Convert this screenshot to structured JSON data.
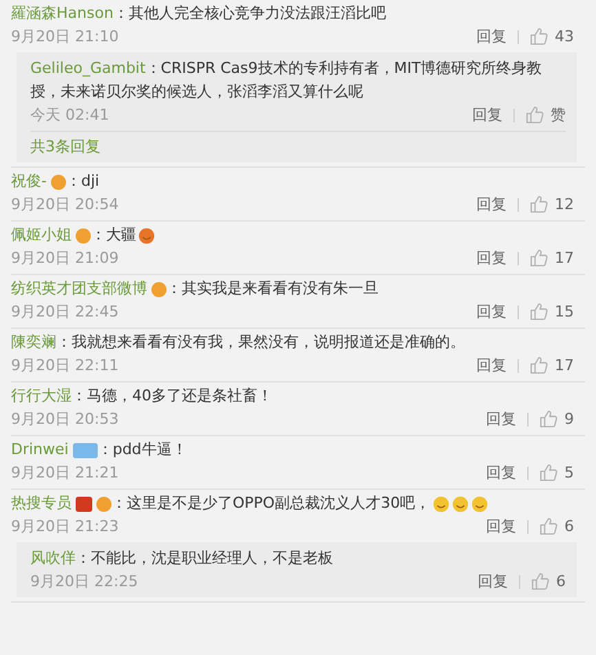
{
  "comments": [
    {
      "user": "羅涵森Hanson",
      "text": "：其他人完全核心竞争力没法跟汪滔比吧",
      "time": "9月20日 21:10",
      "reply": "回复",
      "likes": "43",
      "replies": [
        {
          "user": "Gelileo_Gambit",
          "text": "：CRISPR Cas9技术的专利持有者，MIT博德研究所终身教授，未来诺贝尔奖的候选人，张滔李滔又算什么呢",
          "time": "今天 02:41",
          "reply": "回复",
          "likes": "赞"
        }
      ],
      "more": "共3条回复"
    },
    {
      "user": "祝俊-",
      "badges": [
        {
          "kind": "fan"
        }
      ],
      "text": "：dji",
      "time": "9月20日 20:54",
      "reply": "回复",
      "likes": "12"
    },
    {
      "user": "佩姬小姐",
      "badges": [
        {
          "kind": "fan"
        }
      ],
      "text": "：大疆",
      "emojis": [
        {
          "kind": "fire"
        }
      ],
      "time": "9月20日 21:09",
      "reply": "回复",
      "likes": "17"
    },
    {
      "user": "纺织英才团支部微博",
      "badges": [
        {
          "kind": "fan"
        }
      ],
      "text": "：其实我是来看看有没有朱一旦",
      "time": "9月20日 22:45",
      "reply": "回复",
      "likes": "15"
    },
    {
      "user": "陳奕斓",
      "text": "：我就想来看看有没有我，果然没有，说明报道还是准确的。",
      "time": "9月20日 22:11",
      "reply": "回复",
      "likes": "17"
    },
    {
      "user": "行行大湿",
      "text": "：马德，40多了还是条社畜！",
      "time": "9月20日 20:53",
      "reply": "回复",
      "likes": "9"
    },
    {
      "user": "Drinwei",
      "badges": [
        {
          "kind": "member"
        }
      ],
      "text": "：pdd牛逼！",
      "time": "9月20日 21:21",
      "reply": "回复",
      "likes": "5"
    },
    {
      "user": "热搜专员",
      "badges": [
        {
          "kind": "verified"
        },
        {
          "kind": "fan"
        }
      ],
      "text": "：这里是不是少了OPPO副总裁沈义人才30吧，",
      "emojis": [
        {
          "kind": "laugh"
        },
        {
          "kind": "laugh"
        },
        {
          "kind": "laugh"
        }
      ],
      "time": "9月20日 21:23",
      "reply": "回复",
      "likes": "6",
      "replies": [
        {
          "user": "风吹佯",
          "text": "：不能比，沈是职业经理人，不是老板",
          "time": "9月20日 22:25",
          "reply": "回复",
          "likes": "6"
        }
      ]
    }
  ]
}
